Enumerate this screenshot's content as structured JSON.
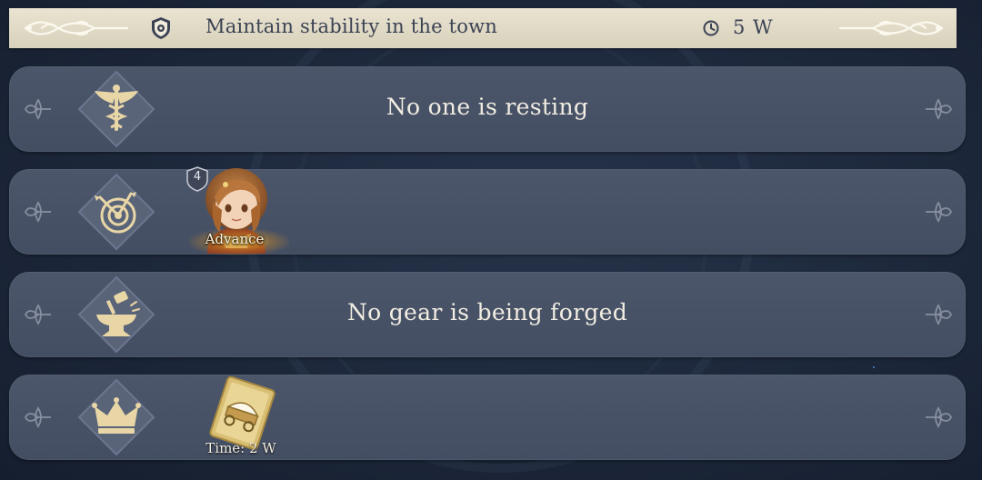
{
  "header": {
    "title": "Maintain stability in the town",
    "time_remaining": "5 W"
  },
  "rows": [
    {
      "icon": "winged-caduceus-icon",
      "status": "No one is resting"
    },
    {
      "icon": "target-arrows-icon",
      "hero": {
        "level": "4",
        "action": "Advance"
      }
    },
    {
      "icon": "anvil-hammer-icon",
      "status": "No gear is being forged"
    },
    {
      "icon": "crown-icon",
      "item": {
        "name": "wagon-card-icon",
        "time_label": "Time:  2 W"
      }
    }
  ],
  "colors": {
    "header_bg": "#e4ddc9",
    "row_bg": "#485267",
    "icon_gold": "#e8d6a6",
    "advance_glow": "#f2b43a",
    "background": "#1c273a"
  }
}
